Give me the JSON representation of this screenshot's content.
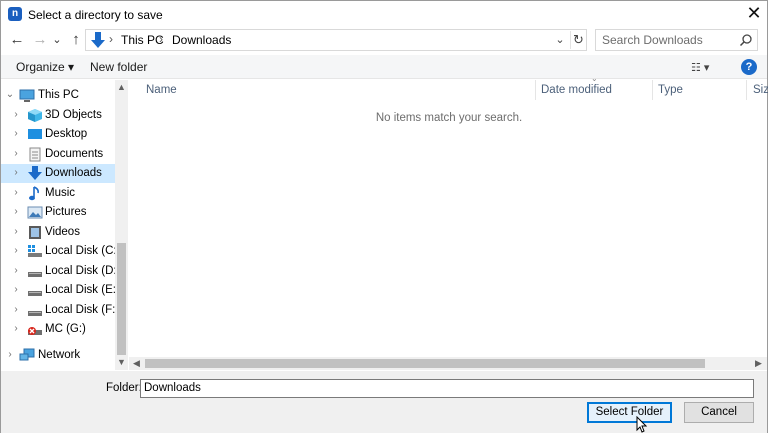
{
  "window": {
    "title": "Select a directory to save",
    "app_icon_letter": "n",
    "close_label": "✕"
  },
  "nav": {
    "back": "←",
    "forward": "→",
    "recent": "⌄",
    "up": "↑"
  },
  "address": {
    "crumbs": [
      "This PC",
      "Downloads"
    ],
    "separator": "›",
    "dropdown": "⌄",
    "refresh": "↻"
  },
  "search": {
    "placeholder": "Search Downloads"
  },
  "toolbar": {
    "organize_label": "Organize ▾",
    "new_folder_label": "New folder",
    "view_label": "☷ ▾",
    "help_label": "?"
  },
  "sidebar": {
    "items": [
      {
        "label": "This PC",
        "icon": "pc-icon"
      },
      {
        "label": "3D Objects",
        "icon": "cube-icon"
      },
      {
        "label": "Desktop",
        "icon": "desktop-icon"
      },
      {
        "label": "Documents",
        "icon": "documents-icon"
      },
      {
        "label": "Downloads",
        "icon": "download-icon",
        "selected": true
      },
      {
        "label": "Music",
        "icon": "music-icon"
      },
      {
        "label": "Pictures",
        "icon": "pictures-icon"
      },
      {
        "label": "Videos",
        "icon": "videos-icon"
      },
      {
        "label": "Local Disk (C:)",
        "icon": "system-drive-icon"
      },
      {
        "label": "Local Disk (D:)",
        "icon": "drive-icon"
      },
      {
        "label": "Local Disk (E:)",
        "icon": "drive-icon"
      },
      {
        "label": "Local Disk (F:)",
        "icon": "drive-icon"
      },
      {
        "label": "MC (G:)",
        "icon": "network-drive-icon"
      },
      {
        "label": "Network",
        "icon": "network-icon"
      }
    ]
  },
  "list": {
    "columns": [
      "Name",
      "Date modified",
      "Type",
      "Size"
    ],
    "empty_message": "No items match your search."
  },
  "footer": {
    "folder_label": "Folder:",
    "folder_value": "Downloads",
    "select_button": "Select Folder",
    "cancel_button": "Cancel"
  },
  "colors": {
    "selection": "#cce8ff",
    "accent": "#0078d7",
    "folder_blue": "#1b6ac9"
  }
}
